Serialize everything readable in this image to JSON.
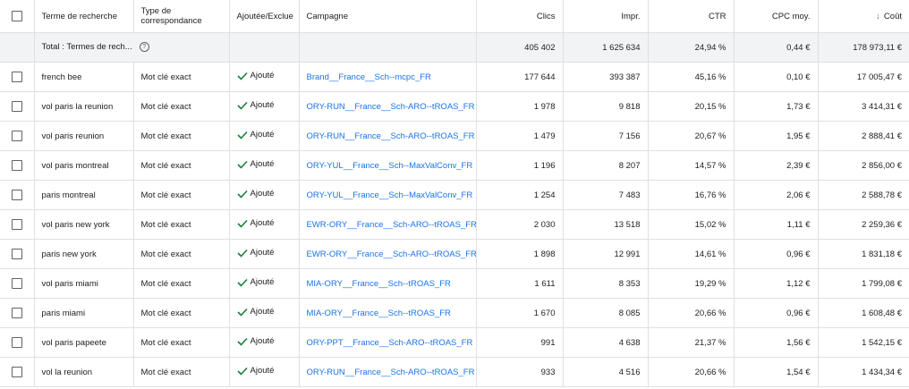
{
  "header": {
    "term": "Terme de recherche",
    "type": "Type de correspondance",
    "added": "Ajoutée/Exclue",
    "campaign": "Campagne",
    "clicks": "Clics",
    "impr": "Impr.",
    "ctr": "CTR",
    "cpc": "CPC moy.",
    "cost": "Coût",
    "sort_arrow": "↓"
  },
  "total": {
    "label": "Total : Termes de rech...",
    "help": "?",
    "clicks": "405 402",
    "impr": "1 625 634",
    "ctr": "24,94 %",
    "cpc": "0,44 €",
    "cost": "178 973,11 €"
  },
  "rows": [
    {
      "term": "french bee",
      "type": "Mot clé exact",
      "status": "Ajouté",
      "campaign": "Brand__France__Sch--mcpc_FR",
      "clicks": "177 644",
      "impr": "393 387",
      "ctr": "45,16 %",
      "cpc": "0,10 €",
      "cost": "17 005,47 €"
    },
    {
      "term": "vol paris la reunion",
      "type": "Mot clé exact",
      "status": "Ajouté",
      "campaign": "ORY-RUN__France__Sch-ARO--tROAS_FR",
      "clicks": "1 978",
      "impr": "9 818",
      "ctr": "20,15 %",
      "cpc": "1,73 €",
      "cost": "3 414,31 €"
    },
    {
      "term": "vol paris reunion",
      "type": "Mot clé exact",
      "status": "Ajouté",
      "campaign": "ORY-RUN__France__Sch-ARO--tROAS_FR",
      "clicks": "1 479",
      "impr": "7 156",
      "ctr": "20,67 %",
      "cpc": "1,95 €",
      "cost": "2 888,41 €"
    },
    {
      "term": "vol paris montreal",
      "type": "Mot clé exact",
      "status": "Ajouté",
      "campaign": "ORY-YUL__France__Sch--MaxValConv_FR",
      "clicks": "1 196",
      "impr": "8 207",
      "ctr": "14,57 %",
      "cpc": "2,39 €",
      "cost": "2 856,00 €"
    },
    {
      "term": "paris montreal",
      "type": "Mot clé exact",
      "status": "Ajouté",
      "campaign": "ORY-YUL__France__Sch--MaxValConv_FR",
      "clicks": "1 254",
      "impr": "7 483",
      "ctr": "16,76 %",
      "cpc": "2,06 €",
      "cost": "2 588,78 €"
    },
    {
      "term": "vol paris new york",
      "type": "Mot clé exact",
      "status": "Ajouté",
      "campaign": "EWR-ORY__France__Sch-ARO--tROAS_FR",
      "clicks": "2 030",
      "impr": "13 518",
      "ctr": "15,02 %",
      "cpc": "1,11 €",
      "cost": "2 259,36 €"
    },
    {
      "term": "paris new york",
      "type": "Mot clé exact",
      "status": "Ajouté",
      "campaign": "EWR-ORY__France__Sch-ARO--tROAS_FR",
      "clicks": "1 898",
      "impr": "12 991",
      "ctr": "14,61 %",
      "cpc": "0,96 €",
      "cost": "1 831,18 €"
    },
    {
      "term": "vol paris miami",
      "type": "Mot clé exact",
      "status": "Ajouté",
      "campaign": "MIA-ORY__France__Sch--tROAS_FR",
      "clicks": "1 611",
      "impr": "8 353",
      "ctr": "19,29 %",
      "cpc": "1,12 €",
      "cost": "1 799,08 €"
    },
    {
      "term": "paris miami",
      "type": "Mot clé exact",
      "status": "Ajouté",
      "campaign": "MIA-ORY__France__Sch--tROAS_FR",
      "clicks": "1 670",
      "impr": "8 085",
      "ctr": "20,66 %",
      "cpc": "0,96 €",
      "cost": "1 608,48 €"
    },
    {
      "term": "vol paris papeete",
      "type": "Mot clé exact",
      "status": "Ajouté",
      "campaign": "ORY-PPT__France__Sch-ARO--tROAS_FR",
      "clicks": "991",
      "impr": "4 638",
      "ctr": "21,37 %",
      "cpc": "1,56 €",
      "cost": "1 542,15 €"
    },
    {
      "term": "vol la reunion",
      "type": "Mot clé exact",
      "status": "Ajouté",
      "campaign": "ORY-RUN__France__Sch-ARO--tROAS_FR",
      "clicks": "933",
      "impr": "4 516",
      "ctr": "20,66 %",
      "cpc": "1,54 €",
      "cost": "1 434,34 €"
    }
  ]
}
